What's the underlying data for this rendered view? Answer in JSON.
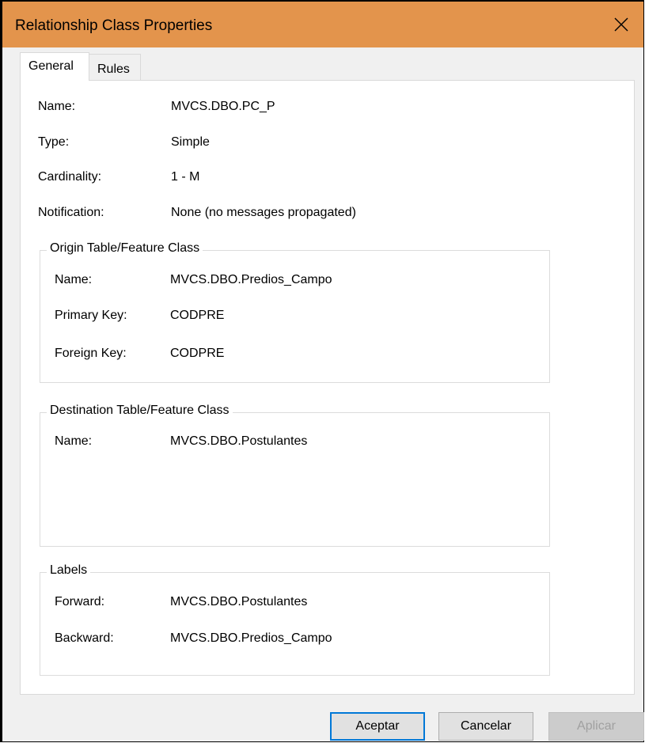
{
  "window": {
    "title": "Relationship Class Properties"
  },
  "tabs": [
    {
      "label": "General",
      "selected": true
    },
    {
      "label": "Rules",
      "selected": false
    }
  ],
  "general": {
    "fields": [
      {
        "label": "Name:",
        "value": "MVCS.DBO.PC_P"
      },
      {
        "label": "Type:",
        "value": "Simple"
      },
      {
        "label": "Cardinality:",
        "value": "1 - M"
      },
      {
        "label": "Notification:",
        "value": "None (no messages propagated)"
      }
    ],
    "origin": {
      "title": "Origin Table/Feature Class",
      "fields": [
        {
          "label": "Name:",
          "value": "MVCS.DBO.Predios_Campo"
        },
        {
          "label": "Primary Key:",
          "value": "CODPRE"
        },
        {
          "label": "Foreign Key:",
          "value": "CODPRE"
        }
      ]
    },
    "destination": {
      "title": "Destination Table/Feature Class",
      "fields": [
        {
          "label": "Name:",
          "value": "MVCS.DBO.Postulantes"
        }
      ]
    },
    "labels": {
      "title": "Labels",
      "fields": [
        {
          "label": "Forward:",
          "value": "MVCS.DBO.Postulantes"
        },
        {
          "label": "Backward:",
          "value": "MVCS.DBO.Predios_Campo"
        }
      ]
    }
  },
  "buttons": {
    "accept": "Aceptar",
    "cancel": "Cancelar",
    "apply": "Aplicar"
  },
  "colors": {
    "titlebar": "#e3944c",
    "accept_focus_border": "#0078d7"
  },
  "icons": {
    "close": "close-icon"
  }
}
